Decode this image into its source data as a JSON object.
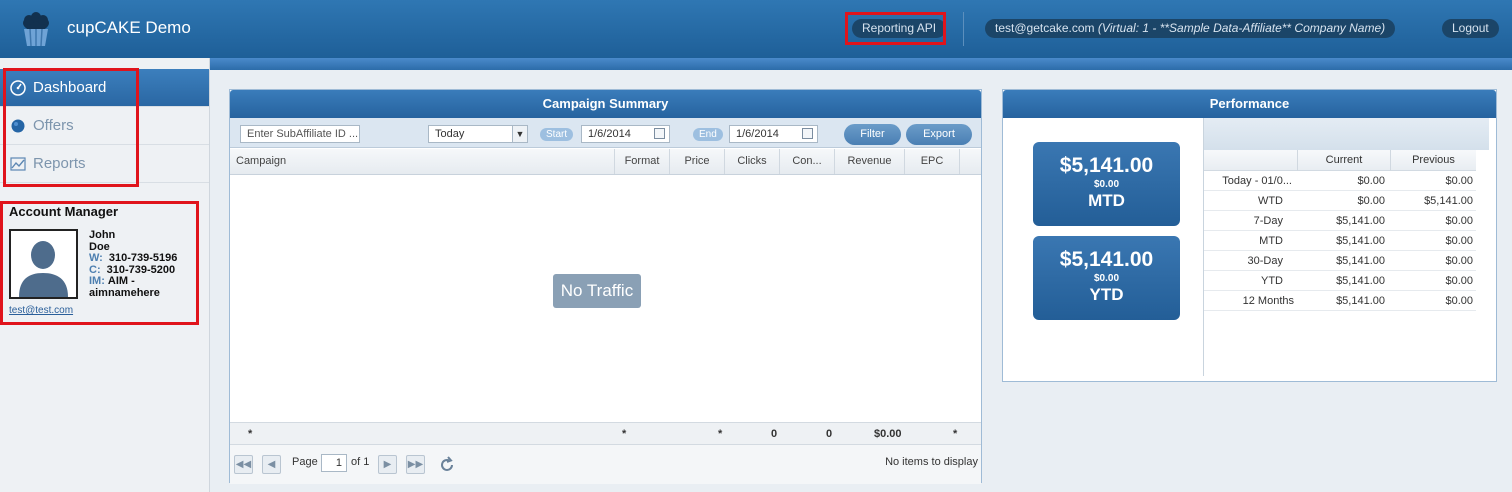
{
  "header": {
    "app_title": "cupCAKE Demo",
    "reporting_api": "Reporting API",
    "user": "test@getcake.com",
    "user_detail": "(Virtual: 1 - **Sample Data-Affiliate** Company Name)",
    "logout": "Logout"
  },
  "sidebar": {
    "items": [
      {
        "label": "Dashboard",
        "icon": "dashboard-icon"
      },
      {
        "label": "Offers",
        "icon": "offers-icon"
      },
      {
        "label": "Reports",
        "icon": "reports-icon"
      }
    ],
    "account_manager": {
      "title": "Account Manager",
      "first_name": "John",
      "last_name": "Doe",
      "work_label": "W:",
      "work": "310-739-5196",
      "cell_label": "C:",
      "cell": "310-739-5200",
      "im_label": "IM:",
      "im": "AIM -",
      "im_name": "aimnamehere",
      "email": "test@test.com"
    }
  },
  "campaign": {
    "title": "Campaign Summary",
    "subaffiliate_placeholder": "Enter SubAffiliate ID ...",
    "range": "Today",
    "start_label": "Start",
    "start_date": "1/6/2014",
    "end_label": "End",
    "end_date": "1/6/2014",
    "filter": "Filter",
    "export": "Export",
    "columns": [
      "Campaign",
      "Format",
      "Price",
      "Clicks",
      "Con...",
      "Revenue",
      "EPC"
    ],
    "empty": "No Traffic",
    "totals": [
      "*",
      "*",
      "*",
      "0",
      "0",
      "$0.00",
      "*"
    ],
    "pager": {
      "page_label": "Page",
      "page": "1",
      "of": "of 1",
      "status": "No items to display"
    }
  },
  "performance": {
    "title": "Performance",
    "mtd": {
      "value": "$5,141.00",
      "sub": "$0.00",
      "label": "MTD"
    },
    "ytd": {
      "value": "$5,141.00",
      "sub": "$0.00",
      "label": "YTD"
    },
    "columns": [
      "Current",
      "Previous"
    ],
    "rows": [
      {
        "label": "Today - 01/0...",
        "current": "$0.00",
        "previous": "$0.00"
      },
      {
        "label": "WTD",
        "current": "$0.00",
        "previous": "$5,141.00"
      },
      {
        "label": "7-Day",
        "current": "$5,141.00",
        "previous": "$0.00"
      },
      {
        "label": "MTD",
        "current": "$5,141.00",
        "previous": "$0.00"
      },
      {
        "label": "30-Day",
        "current": "$5,141.00",
        "previous": "$0.00"
      },
      {
        "label": "YTD",
        "current": "$5,141.00",
        "previous": "$0.00"
      },
      {
        "label": "12 Months",
        "current": "$5,141.00",
        "previous": "$0.00"
      }
    ]
  }
}
